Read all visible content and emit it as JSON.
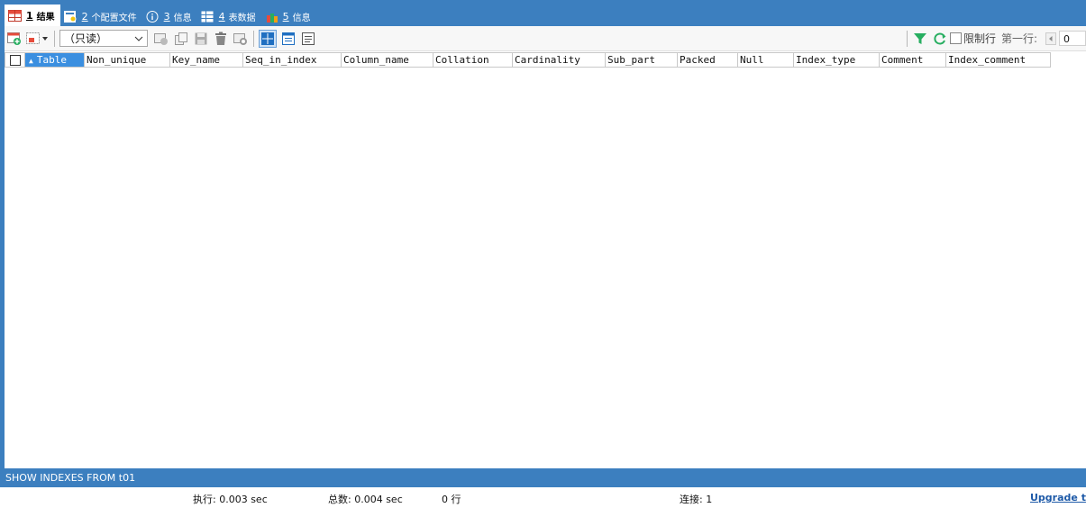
{
  "tabs": [
    {
      "num": "1",
      "label": "结果",
      "icon": "result-grid-icon",
      "active": true
    },
    {
      "num": "2",
      "label": "个配置文件",
      "icon": "profile-icon",
      "active": false
    },
    {
      "num": "3",
      "label": "信息",
      "icon": "info-icon",
      "active": false
    },
    {
      "num": "4",
      "label": "表数据",
      "icon": "table-data-icon",
      "active": false
    },
    {
      "num": "5",
      "label": "信息",
      "icon": "info-chart-icon",
      "active": false
    }
  ],
  "toolbar": {
    "readonly_select": "（只读）",
    "limit_rows_label": "限制行",
    "first_row_label": "第一行:",
    "first_row_value": "0"
  },
  "grid": {
    "columns": [
      "Table",
      "Non_unique",
      "Key_name",
      "Seq_in_index",
      "Column_name",
      "Collation",
      "Cardinality",
      "Sub_part",
      "Packed",
      "Null",
      "Index_type",
      "Comment",
      "Index_comment"
    ],
    "sorted_column": "Table",
    "rows": []
  },
  "status": {
    "query": "SHOW INDEXES FROM t01",
    "exec_time": "执行: 0.003 sec",
    "total_time": "总数: 0.004 sec",
    "rows": "0 行",
    "connection": "连接: 1",
    "upgrade": "Upgrade t"
  },
  "colors": {
    "frame": "#3c7fbf",
    "selected_header": "#3b8fe0",
    "upgrade_link": "#1e5aa8"
  }
}
